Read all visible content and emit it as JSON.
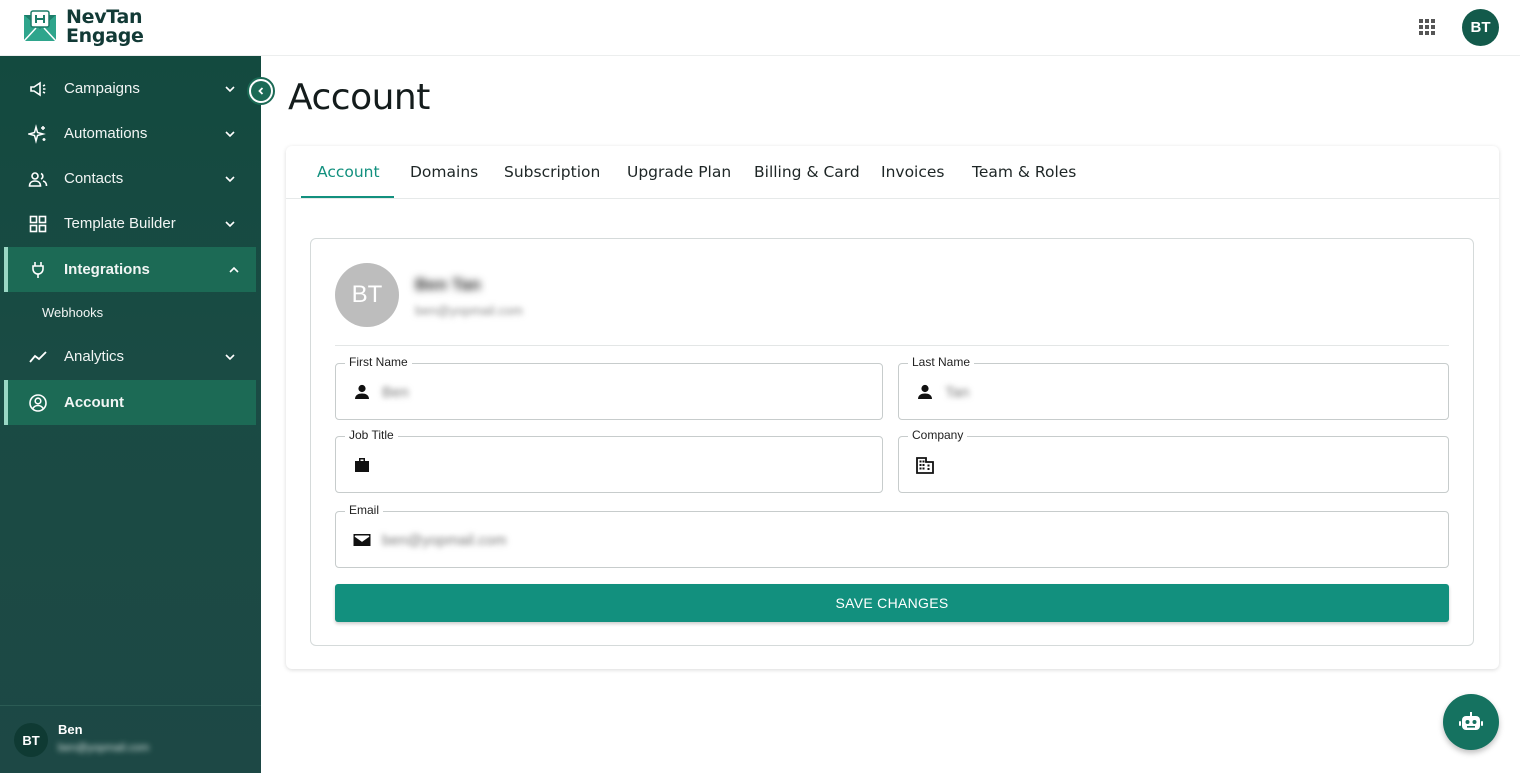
{
  "brand": {
    "line1": "NevTan",
    "line2": "Engage",
    "primary_color": "#12907e",
    "dark_color": "#134a3f"
  },
  "header": {
    "avatar_initials": "BT",
    "apps_icon": "apps-grid-icon"
  },
  "sidebar": {
    "items": [
      {
        "label": "Campaigns",
        "icon": "megaphone-icon",
        "expanded": false
      },
      {
        "label": "Automations",
        "icon": "sparkle-icon",
        "expanded": false
      },
      {
        "label": "Contacts",
        "icon": "people-icon",
        "expanded": false
      },
      {
        "label": "Template Builder",
        "icon": "grid-icon",
        "expanded": false
      },
      {
        "label": "Integrations",
        "icon": "plug-icon",
        "expanded": true,
        "active": true
      },
      {
        "label": "Analytics",
        "icon": "trend-icon",
        "expanded": false
      },
      {
        "label": "Account",
        "icon": "user-circle-icon",
        "active": true
      }
    ],
    "sub_items": [
      {
        "label": "Webhooks"
      }
    ],
    "footer": {
      "initials": "BT",
      "name": "Ben",
      "email": "ben@yopmail.com"
    }
  },
  "main": {
    "title": "Account",
    "tabs": [
      "Account",
      "Domains",
      "Subscription",
      "Upgrade Plan",
      "Billing & Card",
      "Invoices",
      "Team & Roles"
    ],
    "active_tab": "Account",
    "profile": {
      "initials": "BT",
      "name": "Ben Tan",
      "email": "ben@yopmail.com"
    },
    "form": {
      "first_name": {
        "label": "First Name",
        "value": "Ben"
      },
      "last_name": {
        "label": "Last Name",
        "value": "Tan"
      },
      "job_title": {
        "label": "Job Title",
        "value": ""
      },
      "company": {
        "label": "Company",
        "value": ""
      },
      "email": {
        "label": "Email",
        "value": "ben@yopmail.com"
      }
    },
    "save_label": "SAVE CHANGES"
  }
}
